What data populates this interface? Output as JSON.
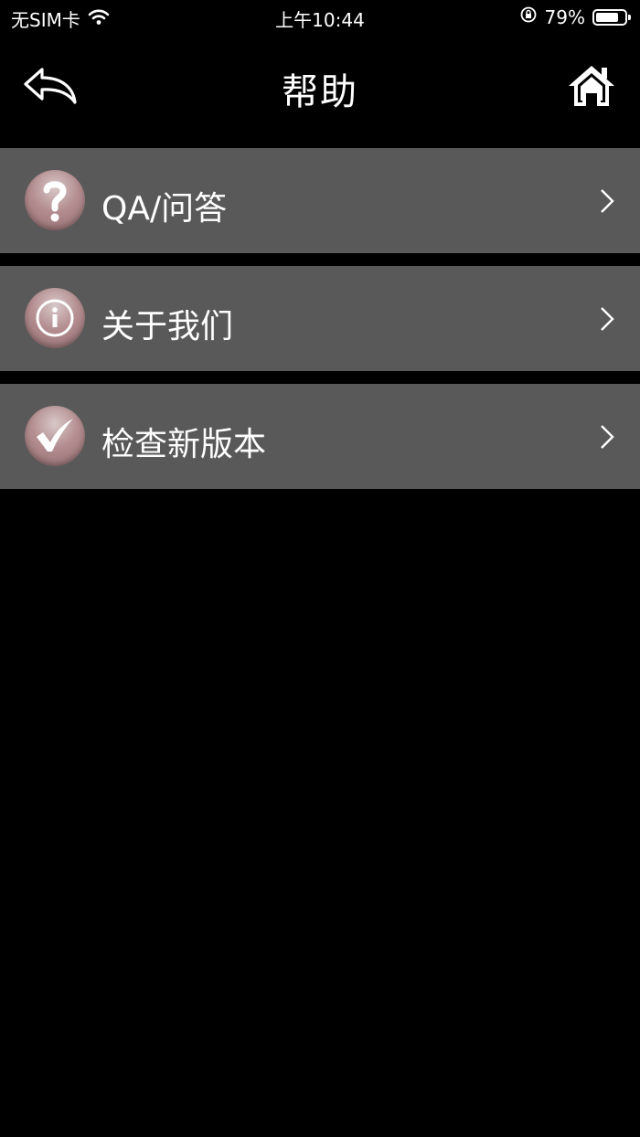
{
  "status_bar": {
    "carrier": "无SIM卡",
    "time": "上午10:44",
    "battery_percent": "79%",
    "battery_level": 0.79,
    "icons": [
      "wifi-icon",
      "rotation-lock-icon",
      "battery-icon"
    ]
  },
  "nav": {
    "title": "帮助",
    "back_icon": "back-arrow-icon",
    "home_icon": "home-icon"
  },
  "menu": {
    "items": [
      {
        "label": "QA/问答",
        "icon": "question-icon"
      },
      {
        "label": "关于我们",
        "icon": "info-icon"
      },
      {
        "label": "检查新版本",
        "icon": "checkmark-icon"
      }
    ]
  },
  "colors": {
    "background": "#000000",
    "row_background": "#595959",
    "icon_gradient_light": "#d8c8c8",
    "icon_gradient_dark": "#8f6a6d",
    "text": "#ffffff"
  }
}
